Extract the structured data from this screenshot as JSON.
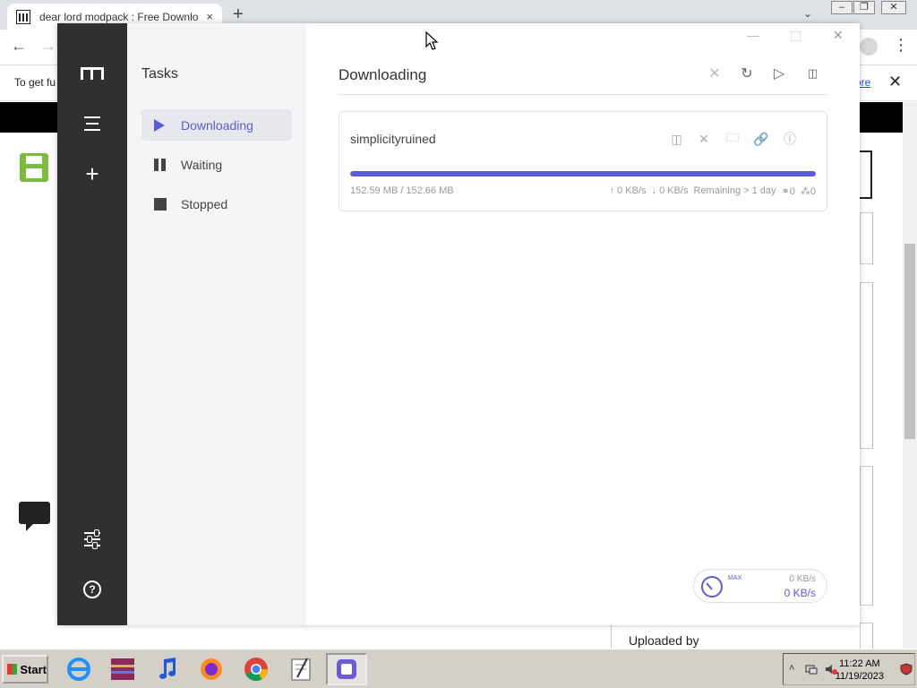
{
  "browser": {
    "tab_title": "dear lord modpack : Free Download",
    "tab_close": "×",
    "new_tab": "+",
    "tab_search": "⌄",
    "win_minimize": "–",
    "win_restore": "❐",
    "win_close": "✕",
    "back": "←",
    "forward": "→",
    "menu": "⋮",
    "infobar_text": "To get fu",
    "infobar_link": "ore",
    "infobar_close": "✕",
    "uploaded_by": "Uploaded by"
  },
  "motrix": {
    "window_minimize": "—",
    "window_maximize": "⬚",
    "window_close": "✕",
    "subnav_title": "Tasks",
    "nav": [
      {
        "label": "Downloading",
        "icon": "play-icon"
      },
      {
        "label": "Waiting",
        "icon": "pause-icon"
      },
      {
        "label": "Stopped",
        "icon": "stop-icon"
      }
    ],
    "main_title": "Downloading",
    "header_actions": {
      "clear": "✕",
      "refresh": "↻",
      "resume_all": "▷",
      "pause_all": "▯▯"
    },
    "task": {
      "name": "simplicityruined",
      "progress_percent": 99.95,
      "size_text": "152.59 MB / 152.66 MB",
      "upload_speed": "↑ 0 KB/s",
      "download_speed": "↓ 0 KB/s",
      "remaining": "Remaining > 1 day",
      "connections": "⚭0",
      "peers": "⁂0",
      "actions": {
        "pause": "▯▯",
        "delete": "✕",
        "folder": "🗀",
        "link": "🔗",
        "info": "ⓘ"
      }
    },
    "speedometer": {
      "max_label": "MAX",
      "upload": "0 KB/s",
      "download": "0 KB/s"
    },
    "colors": {
      "accent": "#5b5bd6",
      "rail": "#303030",
      "subnav": "#f4f5f7"
    }
  },
  "taskbar": {
    "start_label": "Start",
    "clock_time": "11:22 AM",
    "clock_date": "11/19/2023"
  }
}
